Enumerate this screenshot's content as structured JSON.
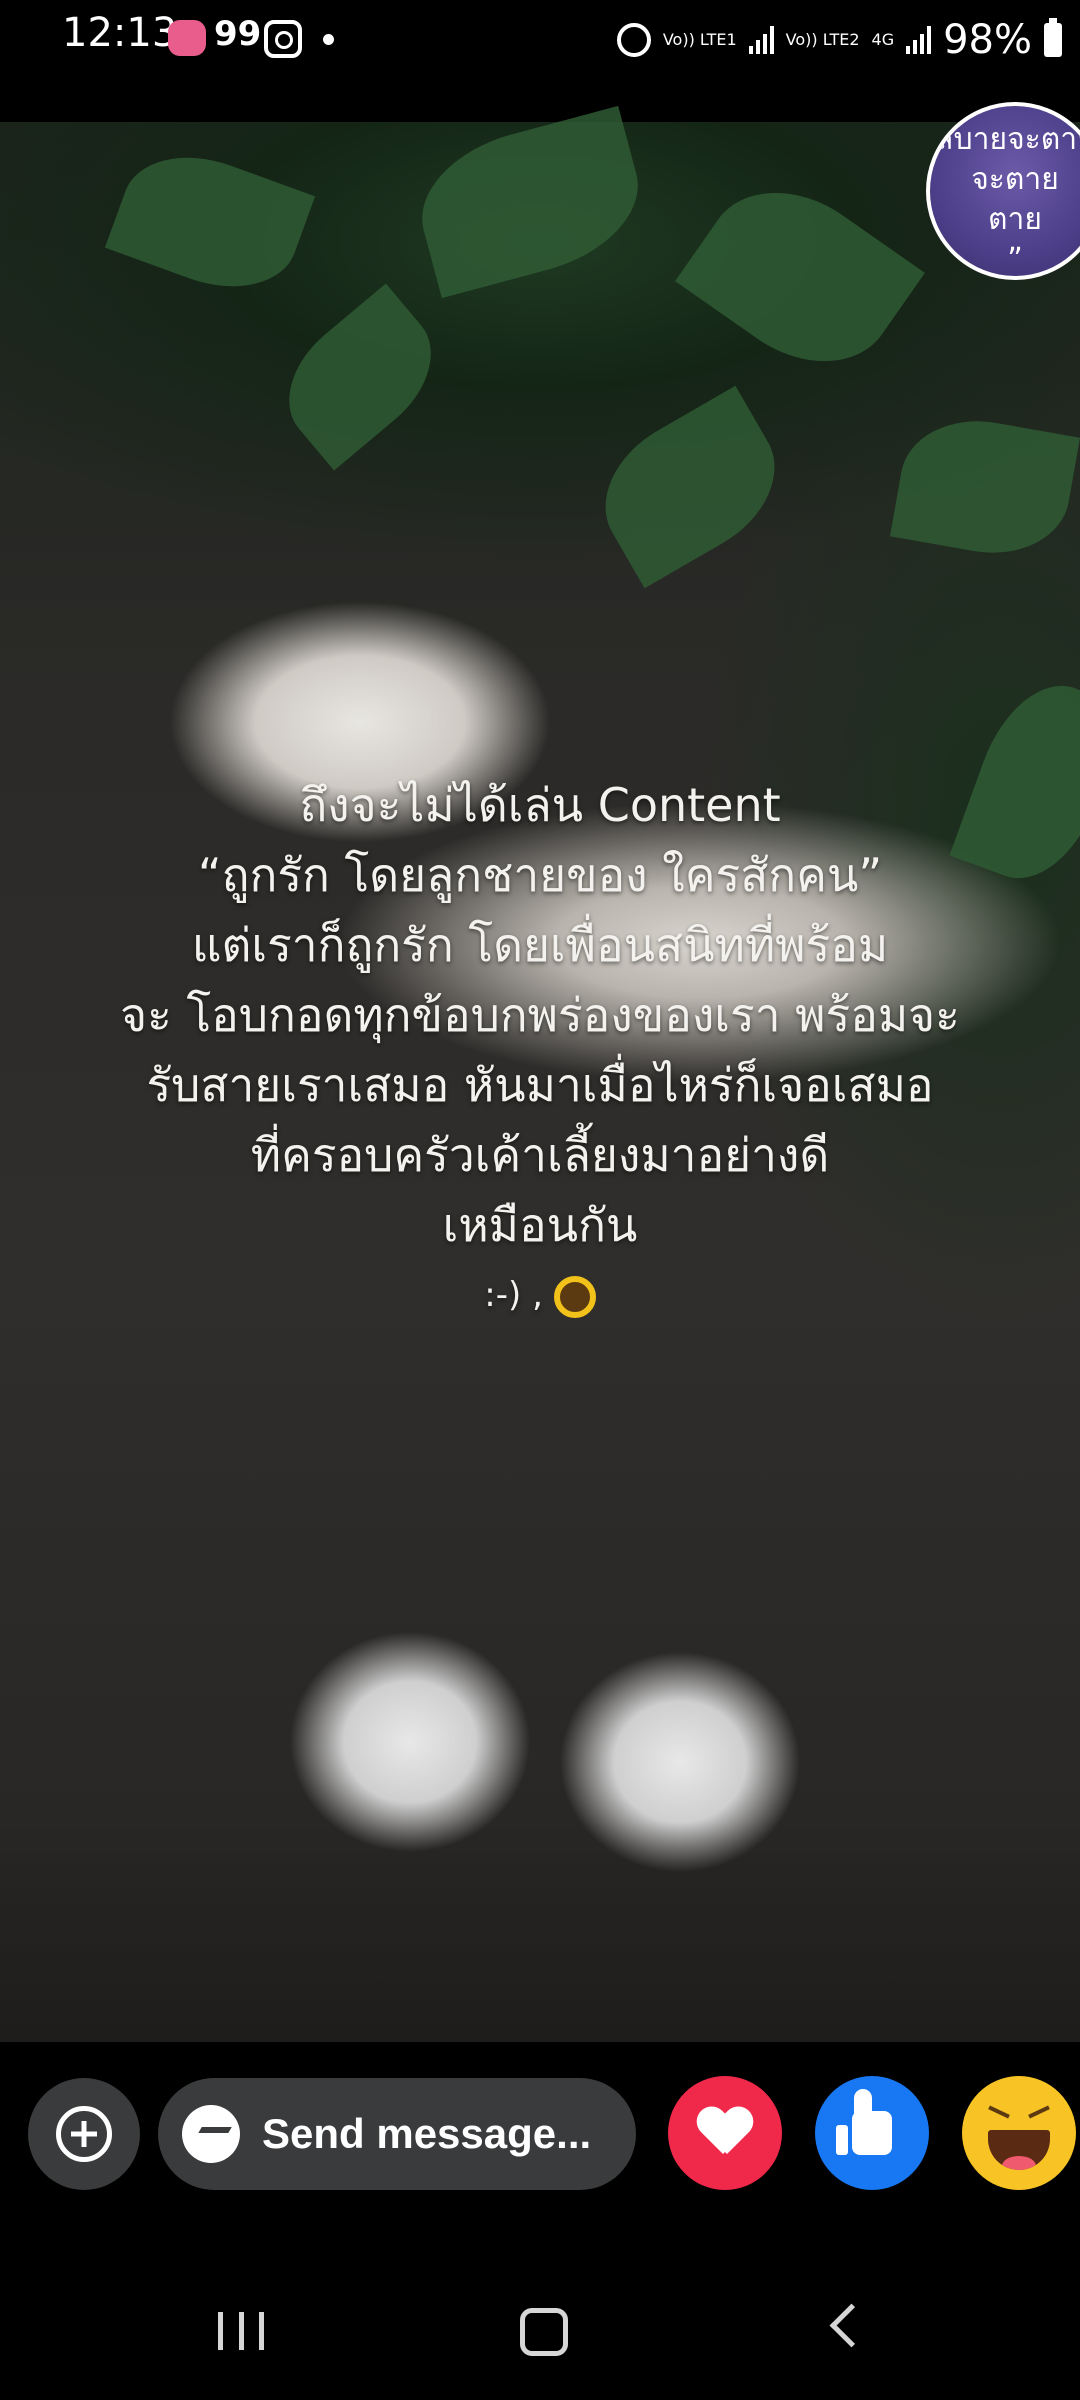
{
  "status_bar": {
    "time": "12:13",
    "notification_count": "99",
    "lte1": "Vo)) LTE1",
    "lte2": "Vo)) LTE2",
    "network": "4G",
    "battery": "98%"
  },
  "story": {
    "avatar_text": [
      "สบายจะตาย",
      "จะตาย",
      "ตาย",
      "”"
    ],
    "caption_lines": [
      "ถึงจะไม่ได้เล่น Content",
      "“ถูกรัก โดยลูกชายของ ใครสักคน”",
      "แต่เราก็ถูกรัก โดยเพื่อนสนิทที่พร้อม",
      "จะ โอบกอดทุกข้อบกพร่องของเรา พร้อมจะ",
      "รับสายเราเสมอ หันมาเมื่อไหร่ก็เจอเสมอ",
      "ที่ครอบครัวเค้าเลี้ยงมาอย่างดี",
      "เหมือนกัน"
    ],
    "caption_emoticon": ":-) ,"
  },
  "bottom_bar": {
    "message_placeholder": "Send message...",
    "reactions": [
      "love",
      "like",
      "haha"
    ],
    "colors": {
      "love": "#f0284a",
      "like": "#1877f2",
      "haha": "#f7c325"
    }
  },
  "icons": [
    "add-icon",
    "messenger-icon",
    "heart-icon",
    "thumbs-up-icon",
    "laughing-face-icon",
    "recents-icon",
    "home-icon",
    "back-icon"
  ]
}
